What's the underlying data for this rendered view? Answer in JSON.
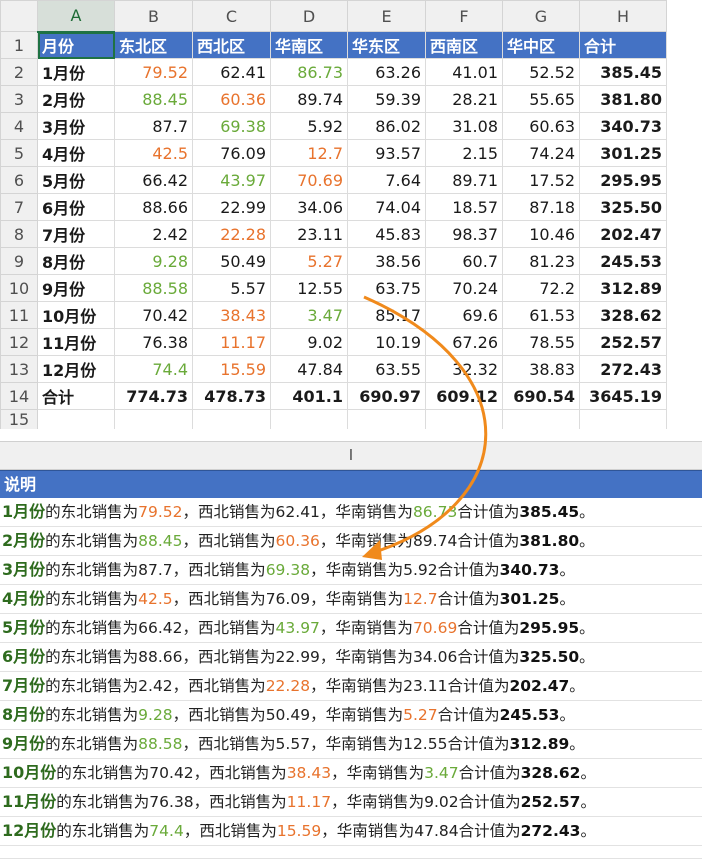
{
  "sheet1": {
    "columns": [
      "A",
      "B",
      "C",
      "D",
      "E",
      "F",
      "G",
      "H"
    ],
    "header_row_num": "1",
    "headers": [
      "月份",
      "东北区",
      "西北区",
      "华南区",
      "华东区",
      "西南区",
      "华中区",
      "合计"
    ],
    "rows": [
      {
        "num": "2",
        "month": "1月份",
        "ne": "79.52",
        "nw": "62.41",
        "sc": "86.73",
        "ec": "63.26",
        "sw": "41.01",
        "cc": "52.52",
        "total": "385.45"
      },
      {
        "num": "3",
        "month": "2月份",
        "ne": "88.45",
        "nw": "60.36",
        "sc": "89.74",
        "ec": "59.39",
        "sw": "28.21",
        "cc": "55.65",
        "total": "381.80"
      },
      {
        "num": "4",
        "month": "3月份",
        "ne": "87.7",
        "nw": "69.38",
        "sc": "5.92",
        "ec": "86.02",
        "sw": "31.08",
        "cc": "60.63",
        "total": "340.73"
      },
      {
        "num": "5",
        "month": "4月份",
        "ne": "42.5",
        "nw": "76.09",
        "sc": "12.7",
        "ec": "93.57",
        "sw": "2.15",
        "cc": "74.24",
        "total": "301.25"
      },
      {
        "num": "6",
        "month": "5月份",
        "ne": "66.42",
        "nw": "43.97",
        "sc": "70.69",
        "ec": "7.64",
        "sw": "89.71",
        "cc": "17.52",
        "total": "295.95"
      },
      {
        "num": "7",
        "month": "6月份",
        "ne": "88.66",
        "nw": "22.99",
        "sc": "34.06",
        "ec": "74.04",
        "sw": "18.57",
        "cc": "87.18",
        "total": "325.50"
      },
      {
        "num": "8",
        "month": "7月份",
        "ne": "2.42",
        "nw": "22.28",
        "sc": "23.11",
        "ec": "45.83",
        "sw": "98.37",
        "cc": "10.46",
        "total": "202.47"
      },
      {
        "num": "9",
        "month": "8月份",
        "ne": "9.28",
        "nw": "50.49",
        "sc": "5.27",
        "ec": "38.56",
        "sw": "60.7",
        "cc": "81.23",
        "total": "245.53"
      },
      {
        "num": "10",
        "month": "9月份",
        "ne": "88.58",
        "nw": "5.57",
        "sc": "12.55",
        "ec": "63.75",
        "sw": "70.24",
        "cc": "72.2",
        "total": "312.89"
      },
      {
        "num": "11",
        "month": "10月份",
        "ne": "70.42",
        "nw": "38.43",
        "sc": "3.47",
        "ec": "85.17",
        "sw": "69.6",
        "cc": "61.53",
        "total": "328.62"
      },
      {
        "num": "12",
        "month": "11月份",
        "ne": "76.38",
        "nw": "11.17",
        "sc": "9.02",
        "ec": "10.19",
        "sw": "67.26",
        "cc": "78.55",
        "total": "252.57"
      },
      {
        "num": "13",
        "month": "12月份",
        "ne": "74.4",
        "nw": "15.59",
        "sc": "47.84",
        "ec": "63.55",
        "sw": "32.32",
        "cc": "38.83",
        "total": "272.43"
      }
    ],
    "total_row": {
      "num": "14",
      "label": "合计",
      "ne": "774.73",
      "nw": "478.73",
      "sc": "401.1",
      "ec": "690.97",
      "sw": "609.12",
      "cc": "690.54",
      "total": "3645.19"
    },
    "partial_row_num": "15"
  },
  "sheet2": {
    "column_label": "I",
    "header": "说明",
    "fragments": {
      "ne_text": "的东北销售为",
      "nw_text": "，西北销售为",
      "sc_text": "，华南销售为",
      "total_text": "合计值为",
      "end": "。"
    }
  },
  "colors": {
    "header_blue": "#4472c4",
    "orange": "#e8732d",
    "green": "#6aaa3a",
    "month_green": "#2e6b1e",
    "arrow": "#f08a1c"
  }
}
